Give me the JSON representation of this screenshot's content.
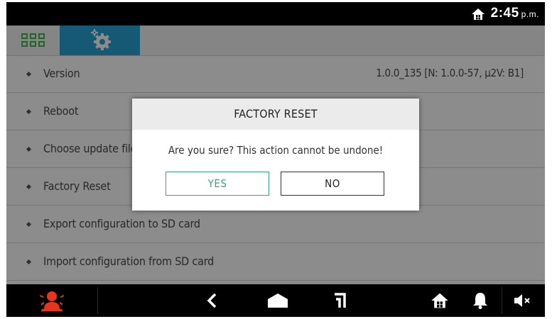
{
  "status_bar": {
    "time": "2:45",
    "ampm": "p.m.",
    "home_icon": "home-icon"
  },
  "tabs": [
    {
      "name": "apps-grid",
      "icon": "grid-icon",
      "active": false
    },
    {
      "name": "settings",
      "icon": "gear-icon",
      "active": true
    }
  ],
  "settings_list": [
    {
      "label": "Version",
      "value": "1.0.0_135 [N: 1.0.0-57, μ2V: B1]"
    },
    {
      "label": "Reboot"
    },
    {
      "label": "Choose update file"
    },
    {
      "label": "Factory Reset"
    },
    {
      "label": "Export configuration to SD card"
    },
    {
      "label": "Import configuration from SD card"
    }
  ],
  "dialog": {
    "title": "FACTORY RESET",
    "message": "Are you sure? This action cannot be undone!",
    "yes_label": "YES",
    "no_label": "NO"
  },
  "nav_bar": {
    "icons": [
      "alarm-icon",
      "back-icon",
      "home-icon",
      "recent-icon",
      "house-icon",
      "bell-icon",
      "mute-icon"
    ]
  },
  "colors": {
    "accent_blue": "#29a3d6",
    "grid_green": "#3cb44a",
    "yes_green": "#3aa57a",
    "alarm_red": "#e8341c"
  }
}
